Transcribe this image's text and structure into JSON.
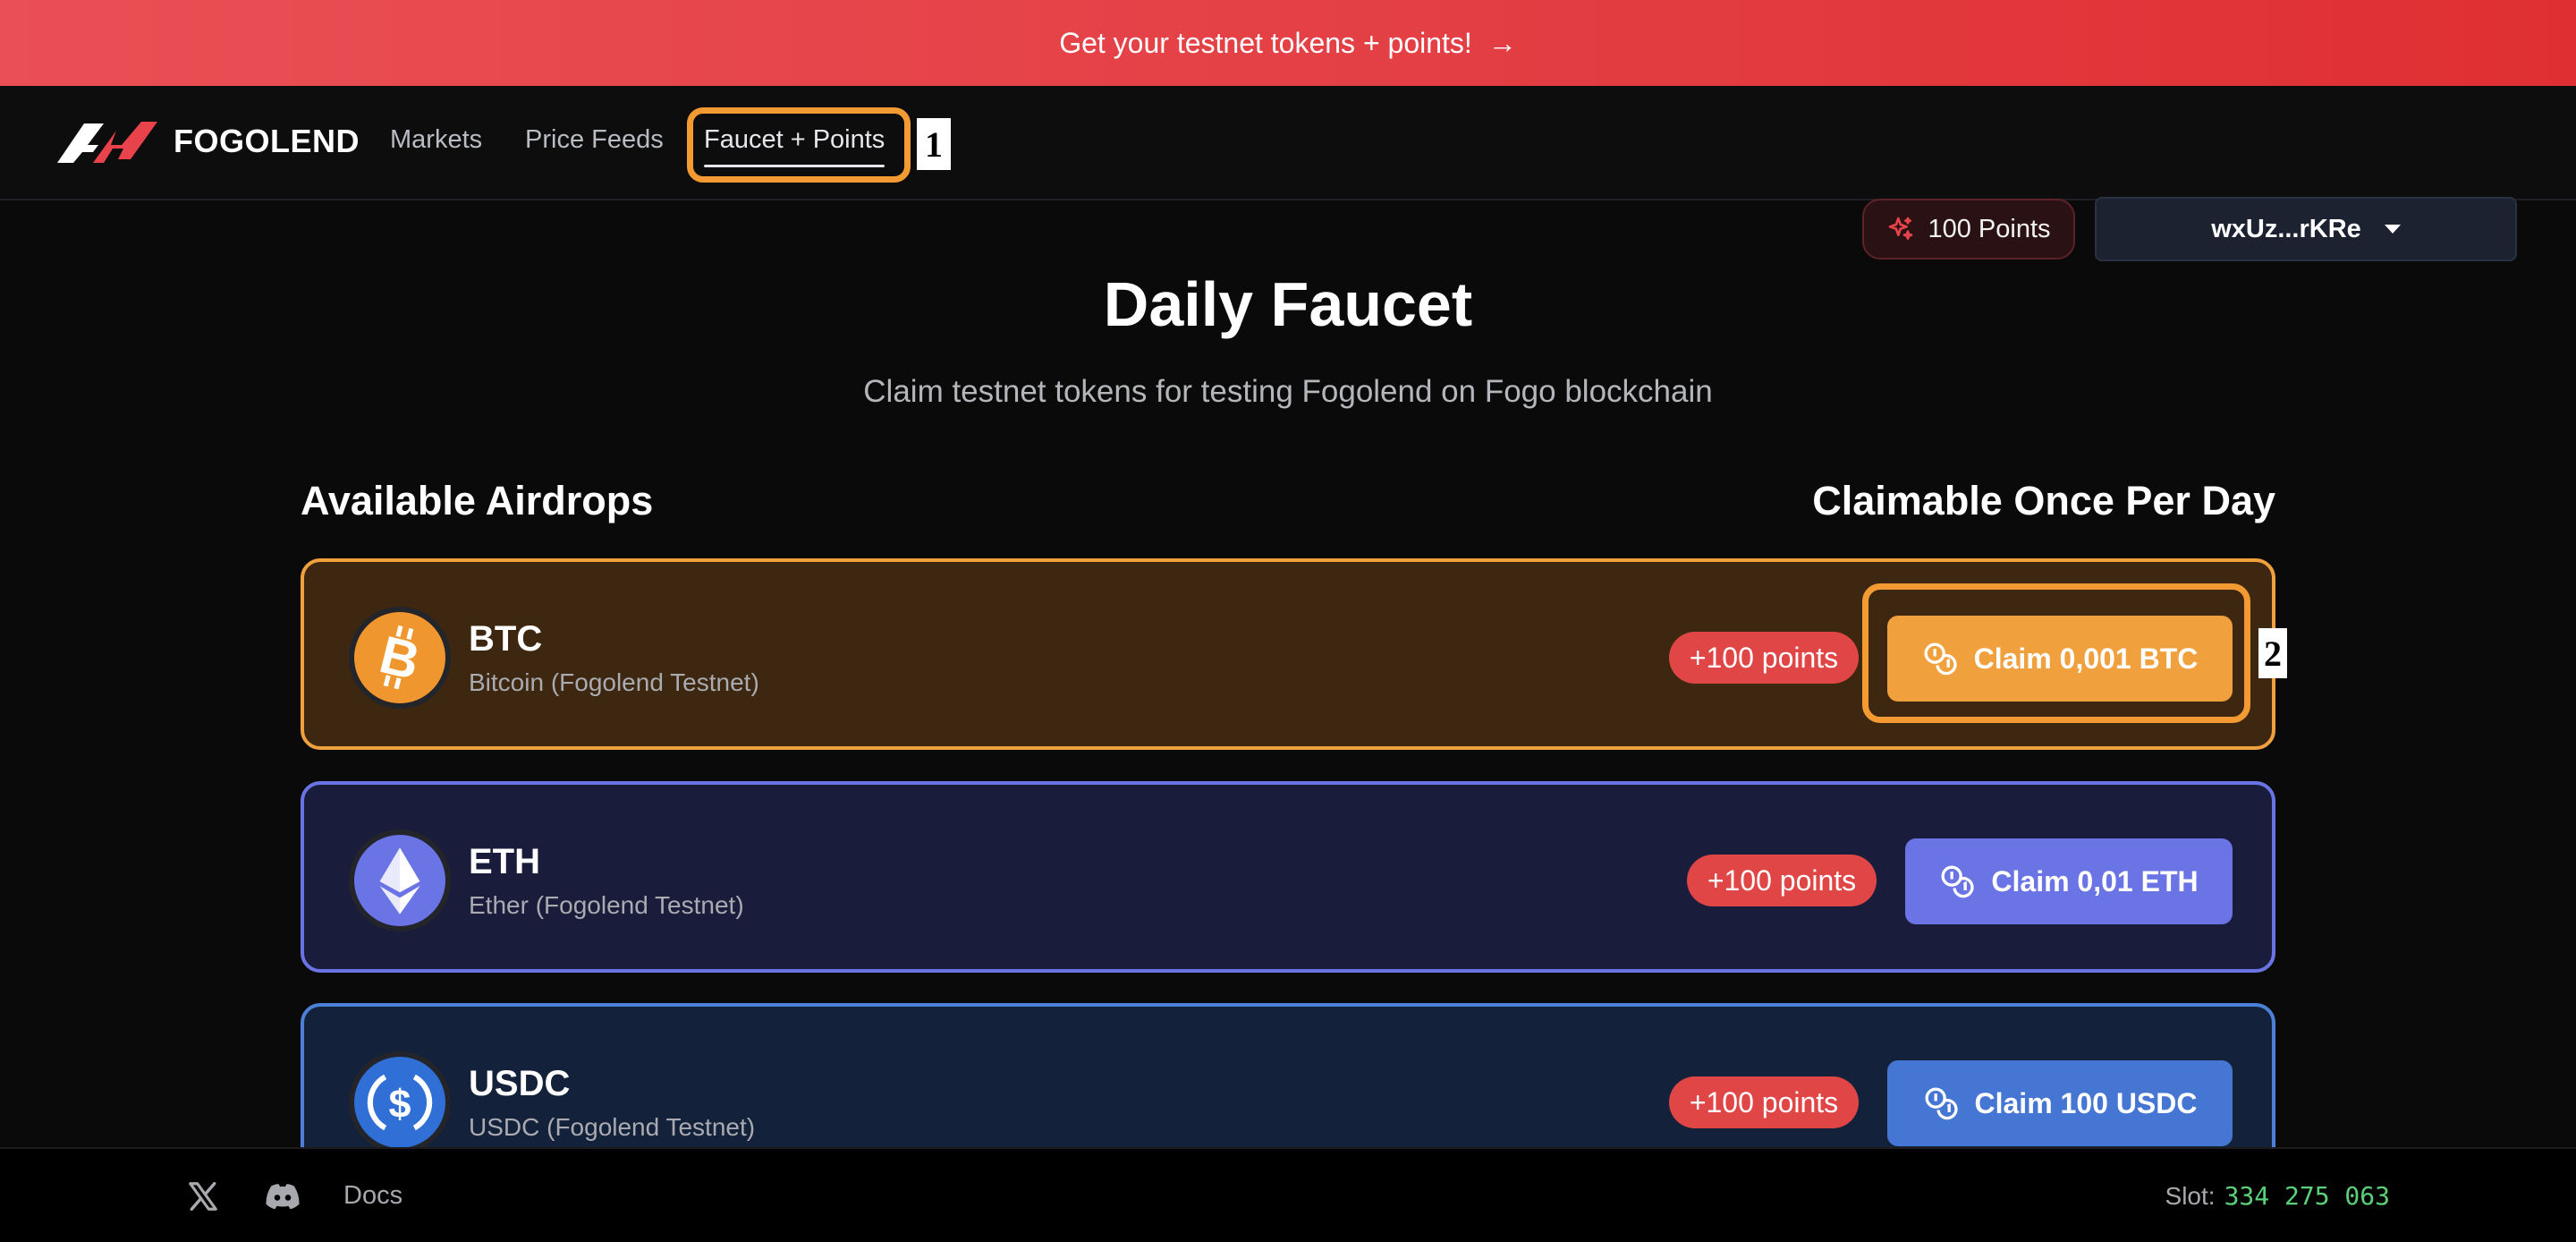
{
  "banner": {
    "text": "Get your testnet tokens + points!",
    "arrow": "→"
  },
  "nav": {
    "brand": "FOGOLEND",
    "links": [
      {
        "label": "Markets"
      },
      {
        "label": "Price Feeds"
      },
      {
        "label": "Faucet + Points",
        "active": true
      }
    ],
    "points_label": "100 Points",
    "wallet_label": "wxUz...rKRe"
  },
  "annotations": {
    "mark1": "1",
    "mark2": "2"
  },
  "page": {
    "title": "Daily Faucet",
    "subtitle": "Claim testnet tokens for testing Fogolend on Fogo blockchain",
    "section_left": "Available Airdrops",
    "section_right": "Claimable Once Per Day"
  },
  "airdrops": [
    {
      "symbol": "BTC",
      "name": "Bitcoin (Fogolend Testnet)",
      "points": "+100 points",
      "claim_label": "Claim 0,001 BTC",
      "color": "#f0a03d"
    },
    {
      "symbol": "ETH",
      "name": "Ether (Fogolend Testnet)",
      "points": "+100 points",
      "claim_label": "Claim 0,01 ETH",
      "color": "#6a74e4"
    },
    {
      "symbol": "USDC",
      "name": "USDC (Fogolend Testnet)",
      "points": "+100 points",
      "claim_label": "Claim 100 USDC",
      "color": "#4676d3"
    }
  ],
  "footer": {
    "docs_label": "Docs",
    "slot_label": "Slot:",
    "slot_value": "334 275 063"
  },
  "icons": [
    "fogolend-logo-icon",
    "sparkle-icon",
    "chevron-down-icon",
    "bitcoin-icon",
    "ethereum-icon",
    "usdc-icon",
    "coins-icon",
    "x-icon",
    "discord-icon"
  ]
}
